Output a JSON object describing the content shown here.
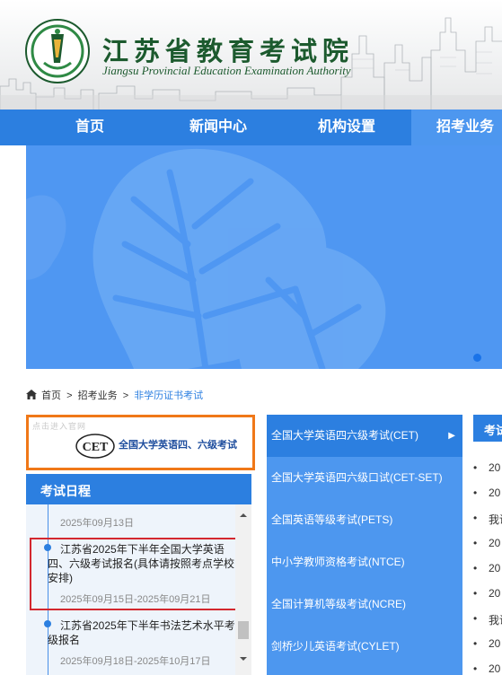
{
  "header": {
    "title": "江苏省教育考试院",
    "subtitle": "Jiangsu Provincial Education Examination Authority"
  },
  "nav": {
    "items": [
      {
        "label": "首页"
      },
      {
        "label": "新闻中心"
      },
      {
        "label": "机构设置"
      },
      {
        "label": "招考业务"
      }
    ],
    "active_index": 3,
    "color": "#2c7fe0"
  },
  "banner": {
    "color": "#4f97f2",
    "slide_count_visible": 1
  },
  "breadcrumb": {
    "home": "首页",
    "sep": ">",
    "section": "招考业务",
    "current": "非学历证书考试"
  },
  "cet_ad": {
    "hint": "点击进入官网",
    "logo_text": "CET",
    "text": "全国大学英语四、六级考试",
    "border_color": "#f07818"
  },
  "schedule": {
    "title": "考试日程",
    "items": [
      {
        "title": "",
        "date": "2025年09月13日"
      },
      {
        "title": "江苏省2025年下半年全国大学英语四、六级考试报名(具体请按照考点学校安排)",
        "date": "2025年09月15日-2025年09月21日"
      },
      {
        "title": "江苏省2025年下半年书法艺术水平考级报名",
        "date": "2025年09月18日-2025年10月17日"
      }
    ]
  },
  "exam_menu": {
    "items": [
      {
        "label": "全国大学英语四六级考试(CET)",
        "arrow": "▶"
      },
      {
        "label": "全国大学英语四六级口试(CET-SET)"
      },
      {
        "label": "全国英语等级考试(PETS)"
      },
      {
        "label": "中小学教师资格考试(NTCE)"
      },
      {
        "label": "全国计算机等级考试(NCRE)"
      },
      {
        "label": "剑桥少儿英语考试(CYLET)"
      }
    ],
    "active_index": 0
  },
  "right_panel": {
    "title": "考试",
    "items": [
      "20",
      "20",
      "我说",
      "20",
      "20",
      "20",
      "我说",
      "20",
      "20"
    ]
  }
}
